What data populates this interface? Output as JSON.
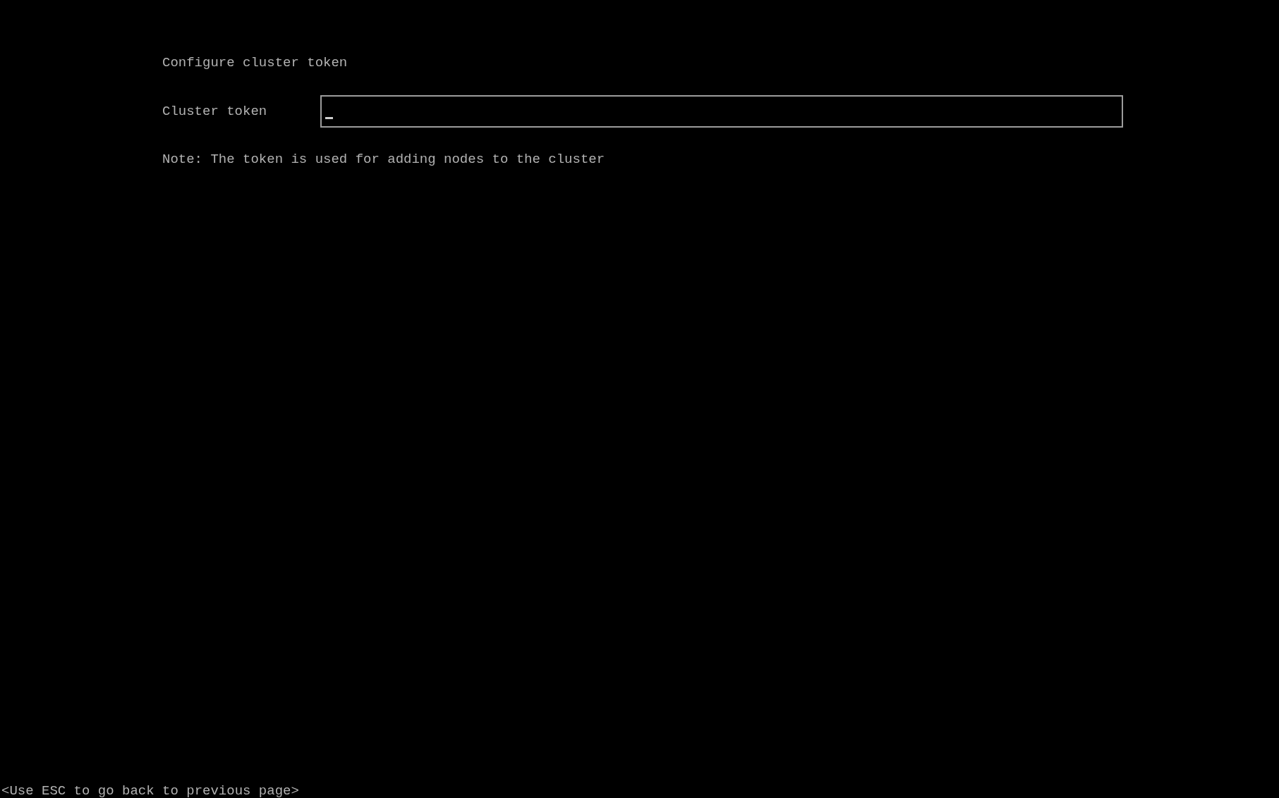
{
  "page": {
    "title": "Configure cluster token"
  },
  "form": {
    "label": "Cluster token",
    "field": {
      "focused": true
    },
    "note": "Note: The token is used for adding nodes to the cluster"
  },
  "footer": {
    "hint": "<Use ESC to go back to previous page>"
  }
}
